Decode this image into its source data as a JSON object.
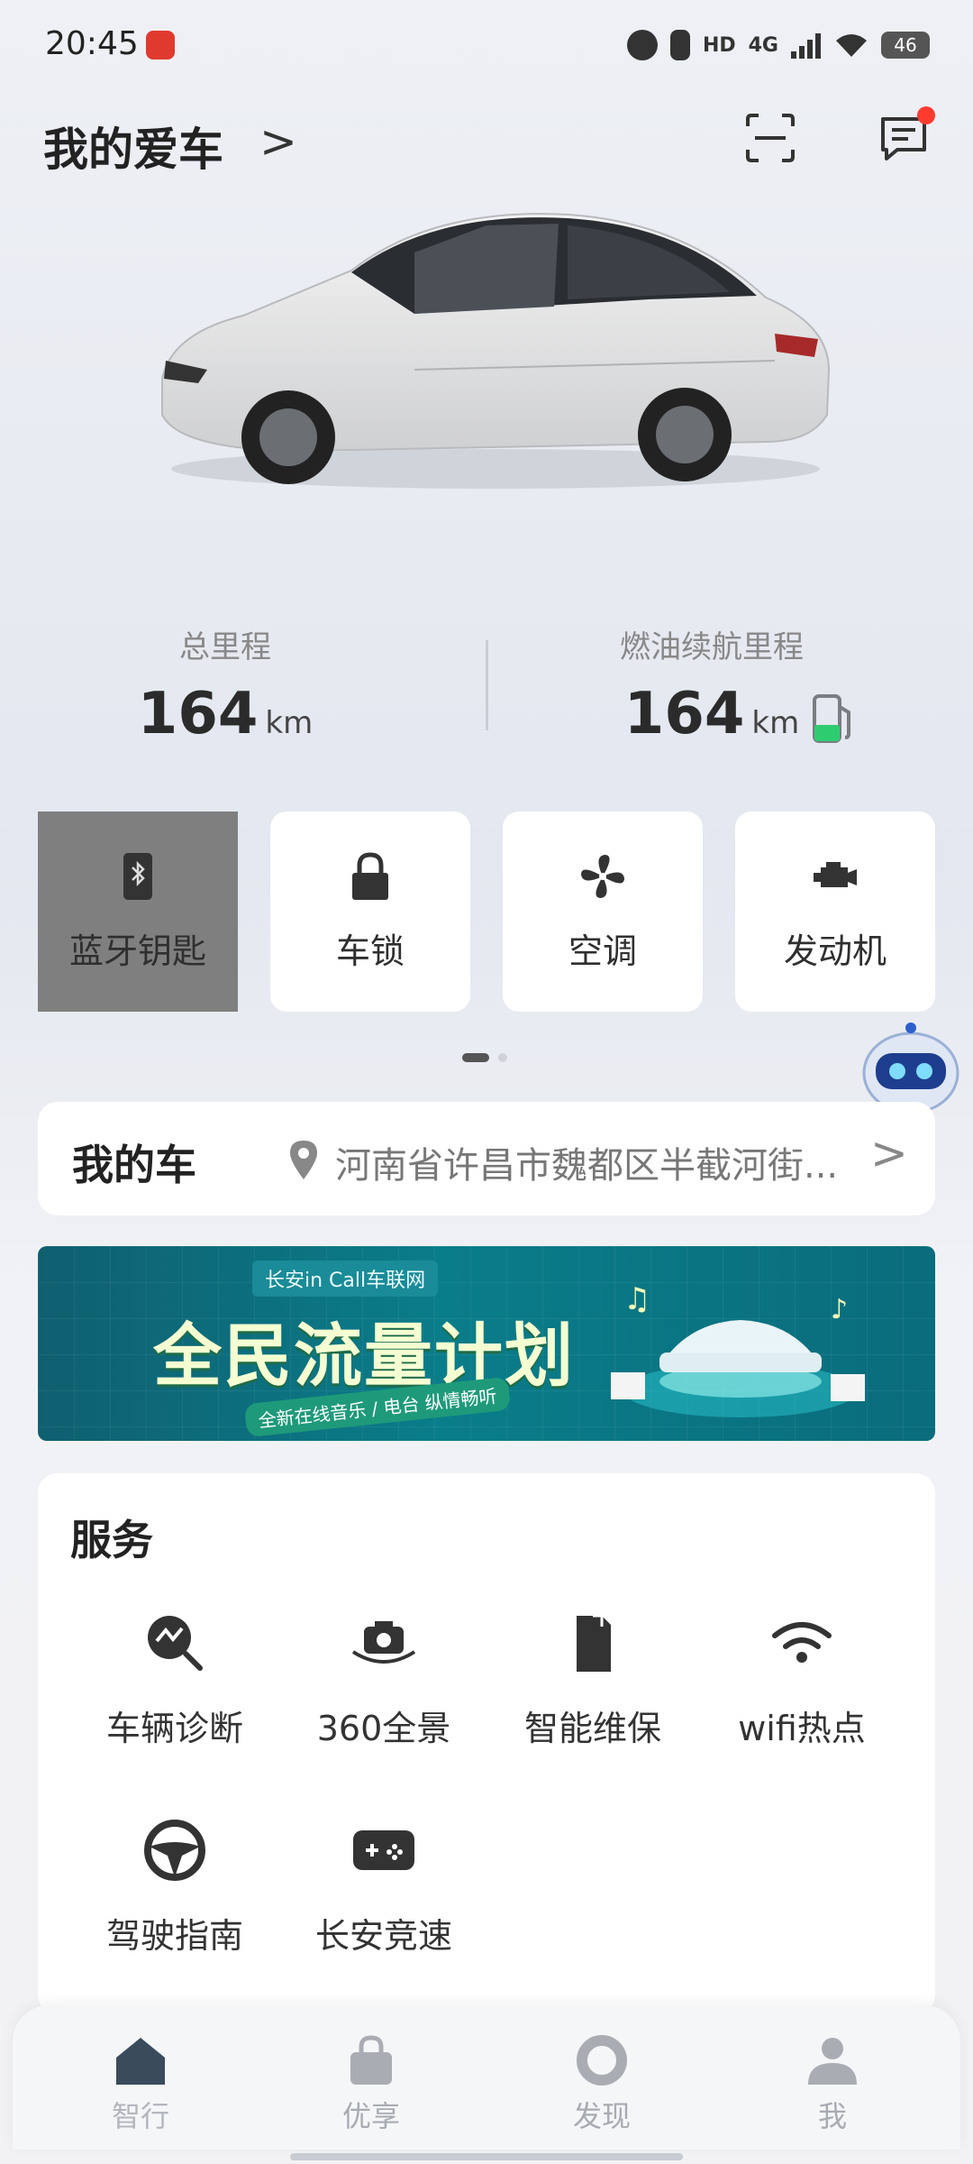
{
  "status_bar": {
    "time": "20:45",
    "network": "4G",
    "hd": "HD",
    "battery": "46",
    "icons": [
      "netease-music-icon",
      "alarm-icon",
      "vibrate-icon",
      "hd-icon",
      "signal-icon",
      "wifi-icon",
      "battery-icon"
    ]
  },
  "header": {
    "title": "我的爱车",
    "chevron": ">",
    "icons": [
      "scan-icon",
      "message-icon"
    ]
  },
  "stats": {
    "total_mileage_label": "总里程",
    "total_mileage_value": "164",
    "total_mileage_unit": "km",
    "fuel_range_label": "燃油续航里程",
    "fuel_range_value": "164",
    "fuel_range_unit": "km"
  },
  "controls": [
    {
      "label": "蓝牙钥匙",
      "icon": "bluetooth-key-icon",
      "active": true
    },
    {
      "label": "车锁",
      "icon": "lock-icon",
      "active": false
    },
    {
      "label": "空调",
      "icon": "fan-icon",
      "active": false
    },
    {
      "label": "发动机",
      "icon": "engine-icon",
      "active": false
    }
  ],
  "my_car": {
    "title": "我的车",
    "address": "河南省许昌市魏都区半截河街...",
    "chevron": ">"
  },
  "banner": {
    "tag": "长安in Call车联网",
    "headline": "全民流量计划",
    "sub": "全新在线音乐 / 电台 纵情畅听"
  },
  "services": {
    "title": "服务",
    "items": [
      {
        "label": "车辆诊断",
        "icon": "diagnosis-icon"
      },
      {
        "label": "360全景",
        "icon": "camera-360-icon"
      },
      {
        "label": "智能维保",
        "icon": "maintenance-icon"
      },
      {
        "label": "wifi热点",
        "icon": "wifi-hotspot-icon"
      },
      {
        "label": "驾驶指南",
        "icon": "steering-wheel-icon"
      },
      {
        "label": "长安竞速",
        "icon": "gamepad-icon"
      }
    ]
  },
  "bottom_nav": [
    {
      "label": "智行",
      "icon": "home-icon"
    },
    {
      "label": "优享",
      "icon": "bag-icon"
    },
    {
      "label": "发现",
      "icon": "discover-icon"
    },
    {
      "label": "我",
      "icon": "profile-icon"
    }
  ]
}
